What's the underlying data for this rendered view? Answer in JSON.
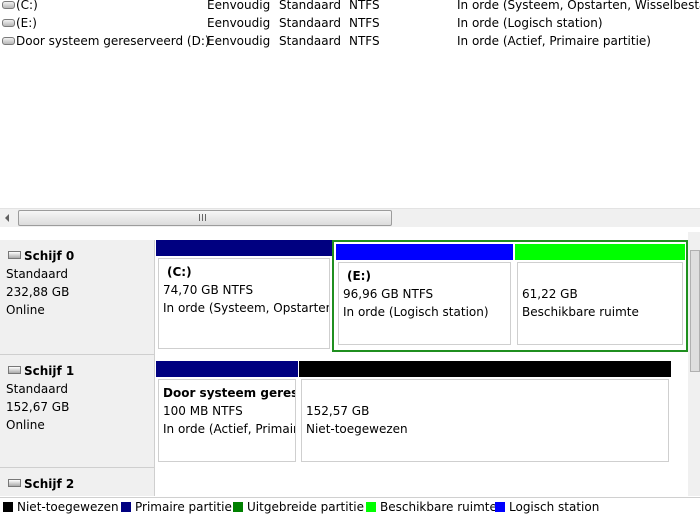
{
  "volumes": [
    {
      "name": "(C:)",
      "indeling": "Eenvoudig",
      "type": "Standaard",
      "fs": "NTFS",
      "status": "In orde (Systeem, Opstarten, Wisselbestand"
    },
    {
      "name": "(E:)",
      "indeling": "Eenvoudig",
      "type": "Standaard",
      "fs": "NTFS",
      "status": "In orde (Logisch station)"
    },
    {
      "name": "Door systeem gereserveerd (D:)",
      "indeling": "Eenvoudig",
      "type": "Standaard",
      "fs": "NTFS",
      "status": "In orde (Actief, Primaire partitie)"
    }
  ],
  "disks": [
    {
      "name": "Schijf 0",
      "type": "Standaard",
      "size": "232,88 GB",
      "state": "Online",
      "partitions": [
        {
          "title": "(C:)",
          "size": "74,70 GB NTFS",
          "status": "In orde (Systeem, Opstarten,"
        },
        {
          "title": "(E:)",
          "size": "96,96 GB NTFS",
          "status": "In orde (Logisch station)"
        },
        {
          "title": "",
          "size": "61,22 GB",
          "status": "Beschikbare ruimte"
        }
      ]
    },
    {
      "name": "Schijf 1",
      "type": "Standaard",
      "size": "152,67 GB",
      "state": "Online",
      "partitions": [
        {
          "title": "Door systeem gerese",
          "size": "100 MB NTFS",
          "status": "In orde (Actief, Primair"
        },
        {
          "title": "",
          "size": "152,57 GB",
          "status": "Niet-toegewezen"
        }
      ]
    },
    {
      "name": "Schijf 2"
    }
  ],
  "legend": [
    {
      "label": "Niet-toegewezen",
      "color": "#000000"
    },
    {
      "label": "Primaire partitie",
      "color": "#000080"
    },
    {
      "label": "Uitgebreide partitie",
      "color": "#008000"
    },
    {
      "label": "Beschikbare ruimte",
      "color": "#00ff00"
    },
    {
      "label": "Logisch station",
      "color": "#0000ff"
    }
  ],
  "colors": {
    "primary": "#000080",
    "logical": "#0000ff",
    "free": "#00ff00",
    "unallocated": "#000000",
    "extended": "#008000"
  },
  "scrollbar": {
    "grip": "III"
  }
}
